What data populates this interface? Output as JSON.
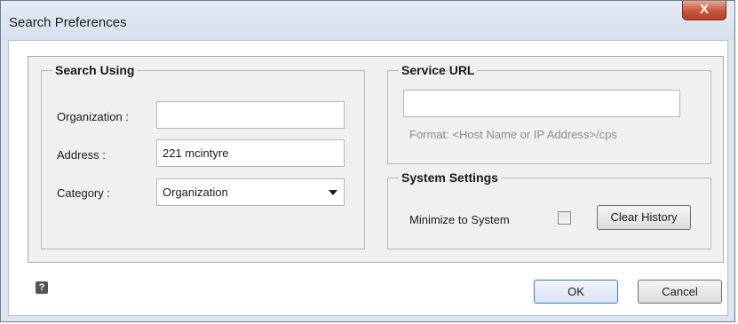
{
  "window": {
    "title": "Search Preferences",
    "close_glyph": "X"
  },
  "search_using": {
    "legend": "Search Using",
    "organization_label": "Organization :",
    "organization_value": "",
    "address_label": "Address :",
    "address_value": "221 mcintyre",
    "category_label": "Category :",
    "category_value": "Organization"
  },
  "service_url": {
    "legend": "Service URL",
    "value": "",
    "format_hint": "Format: <Host Name or IP Address>/cps"
  },
  "system_settings": {
    "legend": "System Settings",
    "minimize_label": "Minimize to System",
    "minimize_checked": false,
    "clear_history_label": "Clear History"
  },
  "footer": {
    "help_glyph": "?",
    "ok_label": "OK",
    "cancel_label": "Cancel"
  },
  "icons": [
    "close-icon",
    "chevron-down-icon",
    "help-icon"
  ]
}
